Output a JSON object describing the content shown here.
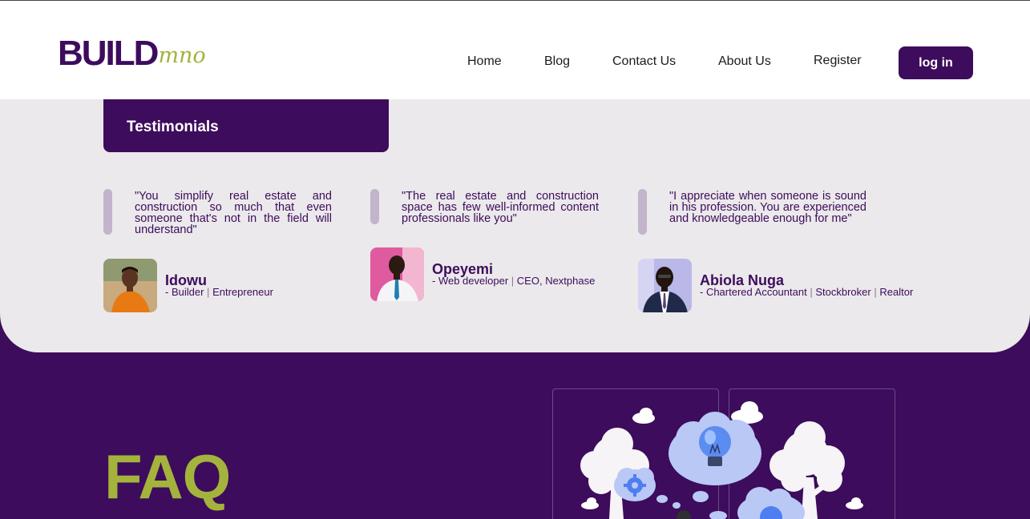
{
  "brand": {
    "main": "BUILD",
    "accent": "mno"
  },
  "nav": {
    "items": [
      "Home",
      "Blog",
      "Contact Us",
      "About Us",
      "Register"
    ],
    "login_label": "log in"
  },
  "testimonials": {
    "heading": "Testimonials",
    "items": [
      {
        "quote": "\"You simplify real estate and construction so much that even someone that's not in the field will understand\"",
        "name": "Idowu",
        "role_parts": [
          "- Builder",
          "Entrepreneur"
        ]
      },
      {
        "quote": "\"The real estate and construction space has few well-informed content professionals like you\"",
        "name": "Opeyemi",
        "role_parts": [
          "- Web developer",
          "CEO, Nextphase"
        ]
      },
      {
        "quote": "\"I appreciate when someone is sound in his profession. You are experienced and knowledgeable enough for me\"",
        "name": "Abiola Nuga",
        "role_parts": [
          "- Chartered Accountant",
          "Stockbroker",
          "Realtor"
        ]
      }
    ]
  },
  "faq": {
    "title": "FAQ"
  },
  "colors": {
    "brand_purple": "#3d0c5c",
    "brand_green": "#a4b33c",
    "panel_gray": "#ebe9eb"
  }
}
